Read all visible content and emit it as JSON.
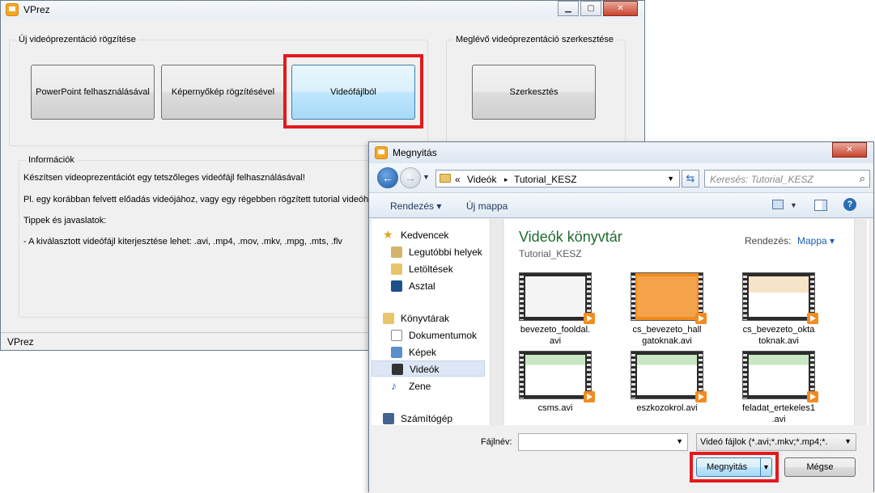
{
  "main_window": {
    "title": "VPrez",
    "caption": {
      "minimize": "▁",
      "maximize": "▢",
      "close": "✕"
    },
    "new_group_title": "Új videóprezentáció rögzítése",
    "buttons": {
      "powerpoint": "PowerPoint felhasználásával",
      "screen": "Képernyőkép rögzítésével",
      "video": "Videófájlból",
      "edit": "Szerkesztés"
    },
    "edit_group_title": "Meglévő videóprezentáció szerkesztése",
    "info_group_title": "Információk",
    "info_lines": [
      "Készítsen videoprezentációt egy tetszőleges videófájl felhasználásával!",
      "Pl. egy korábban felvett előadás videójához, vagy egy régebben rögzített tutorial videóhoz.",
      "Tippek és javaslatok:",
      "- A kiválasztott videófájl kiterjesztése lehet: .avi, .mp4, .mov, .mkv, .mpg, .mts, .flv"
    ],
    "status": "VPrez"
  },
  "dialog": {
    "title": "Megnyitás",
    "close": "✕",
    "breadcrumb": {
      "overflow": "«",
      "sep1": "▸",
      "part1": "Videók",
      "sep2": "▸",
      "part2": "Tutorial_KESZ"
    },
    "search_placeholder": "Keresés: Tutorial_KESZ",
    "toolbar": {
      "organize": "Rendezés ▾",
      "new_folder": "Új mappa"
    },
    "nav": {
      "favorites": "Kedvencek",
      "recent": "Legutóbbi helyek",
      "downloads": "Letöltések",
      "desktop": "Asztal",
      "libraries": "Könyvtárak",
      "documents": "Dokumentumok",
      "pictures": "Képek",
      "videos": "Videók",
      "music": "Zene",
      "computer": "Számítógép"
    },
    "library_title": "Videók könyvtár",
    "library_sub": "Tutorial_KESZ",
    "arrange_label": "Rendezés:",
    "arrange_value": "Mappa ▾",
    "files": [
      {
        "name1": "bevezeto_fooldal.",
        "name2": "avi"
      },
      {
        "name1": "cs_bevezeto_hall",
        "name2": "gatoknak.avi"
      },
      {
        "name1": "cs_bevezeto_okta",
        "name2": "toknak.avi"
      },
      {
        "name1": "csms.avi",
        "name2": ""
      },
      {
        "name1": "eszkozokrol.avi",
        "name2": ""
      },
      {
        "name1": "feladat_ertekeles1",
        "name2": ".avi"
      }
    ],
    "filename_label": "Fájlnév:",
    "filename_value": "",
    "filter": "Videó fájlok (*.avi;*.mkv;*.mp4;*.",
    "open_button": "Megnyitás",
    "cancel_button": "Mégse"
  }
}
